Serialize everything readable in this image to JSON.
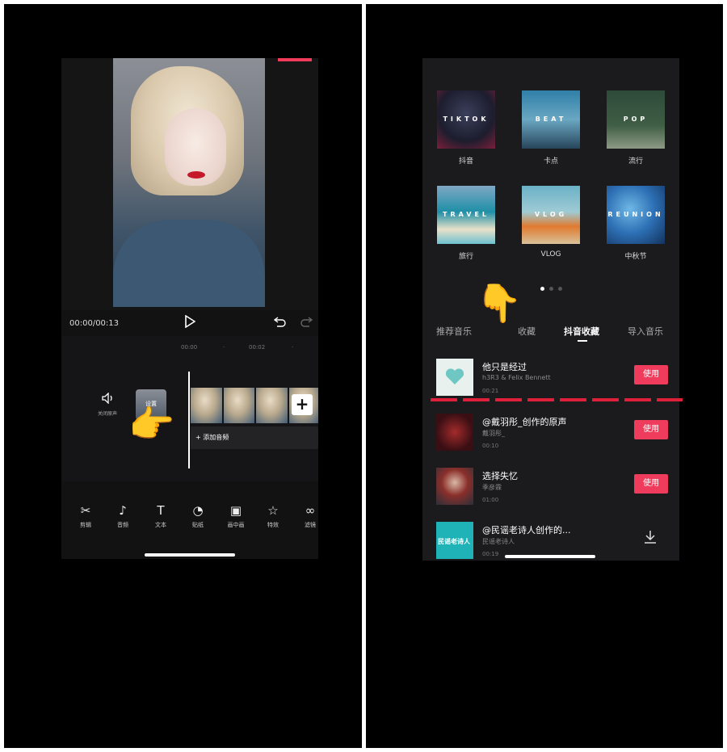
{
  "left": {
    "timecode": "00:00/00:13",
    "timeline_ticks": [
      "00:00",
      "00:02"
    ],
    "mute_label": "关闭原声",
    "cover_label": "设置",
    "add_audio_label": "+ 添加音频",
    "tools": [
      {
        "icon": "scissors-icon",
        "label": "剪辑"
      },
      {
        "icon": "music-note-icon",
        "label": "音频"
      },
      {
        "icon": "text-icon",
        "label": "文本"
      },
      {
        "icon": "sticker-icon",
        "label": "贴纸"
      },
      {
        "icon": "picture-in-picture-icon",
        "label": "画中画"
      },
      {
        "icon": "effects-icon",
        "label": "特效"
      },
      {
        "icon": "filter-icon",
        "label": "滤镜"
      }
    ]
  },
  "right": {
    "categories": [
      {
        "tag": "TIKTOK",
        "label": "抖音"
      },
      {
        "tag": "BEAT",
        "label": "卡点"
      },
      {
        "tag": "POP",
        "label": "流行"
      },
      {
        "tag": "TRAVEL",
        "label": "旅行"
      },
      {
        "tag": "VLOG",
        "label": "VLOG"
      },
      {
        "tag": "REUNION",
        "label": "中秋节"
      }
    ],
    "tabs": [
      "推荐音乐",
      "收藏",
      "抖音收藏",
      "导入音乐"
    ],
    "songs": [
      {
        "title": "他只是经过",
        "artist": "h3R3 & Felix Bennett",
        "duration": "00:21",
        "action": "使用"
      },
      {
        "title": "@戴羽彤_创作的原声",
        "artist": "戴羽彤_",
        "duration": "00:10",
        "action": "使用"
      },
      {
        "title": "选择失忆",
        "artist": "季彦霖",
        "duration": "01:00",
        "action": "使用"
      },
      {
        "title": "@民谣老诗人创作的...",
        "artist": "民谣老诗人",
        "duration": "00:19",
        "action": "download-icon",
        "cover_text": "民谣老诗人"
      }
    ]
  },
  "colors": {
    "accent": "#ef3c5c",
    "background": "#000000",
    "panel": "#1b1b1e"
  }
}
